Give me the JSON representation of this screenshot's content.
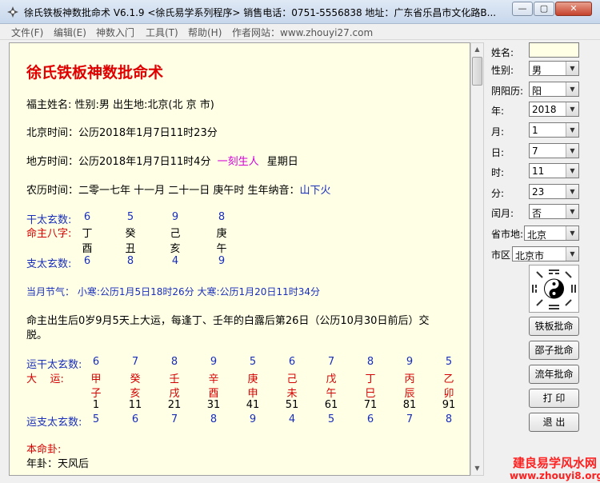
{
  "window": {
    "title": "徐氏铁板神数批命术 V6.1.9 <徐氏易学系列程序>   销售电话：0751-5556838   地址：广东省乐昌市文化路B...",
    "min_btn": "—",
    "max_btn": "▢",
    "close_btn": "✕"
  },
  "menu": [
    "文件(F)",
    "编辑(E)",
    "神数入门",
    "工具(T)",
    "帮助(H)",
    "作者网站：www.zhouyi27.com"
  ],
  "content": {
    "title": "徐氏铁板神数批命术",
    "line_person": "福主姓名:   性别:男   出生地:北京(北 京 市)",
    "line_beijing_time": "北京时间：公历2018年1月7日11时23分",
    "line_local_time_prefix": "地方时间：公历2018年1月7日11时4分",
    "line_local_time_ke": "一刻生人",
    "line_local_time_suffix": "星期日",
    "line_lunar_prefix": "农历时间：二零一七年 十一月 二十一日 庚午时    生年纳音：",
    "line_lunar_nayin": "山下火",
    "bazi": {
      "gan_label": "干太玄数:",
      "gan_nums": [
        "6",
        "5",
        "9",
        "8"
      ],
      "bazi_label": "命主八字:",
      "tiangan": [
        "丁",
        "癸",
        "己",
        "庚"
      ],
      "dizhi": [
        "酉",
        "丑",
        "亥",
        "午"
      ],
      "zhi_label": "支太玄数:",
      "zhi_nums": [
        "6",
        "8",
        "4",
        "9"
      ]
    },
    "jieqi": "当月节气： 小寒:公历1月5日18时26分 大寒:公历1月20日11时34分",
    "dayun_line1": "命主出生后0岁9月5天上大运，每逢丁、壬年的白露后第26日（公历10月30日前后）交",
    "dayun_line2": "脱。",
    "yun": {
      "gan_label": "运干太玄数:",
      "gan_nums": [
        "6",
        "7",
        "8",
        "9",
        "5",
        "6",
        "7",
        "8",
        "9",
        "5"
      ],
      "dayun_label": "大    运:",
      "gan_chars": [
        "甲",
        "癸",
        "壬",
        "辛",
        "庚",
        "己",
        "戊",
        "丁",
        "丙",
        "乙"
      ],
      "zhi_chars": [
        "子",
        "亥",
        "戌",
        "酉",
        "申",
        "未",
        "午",
        "巳",
        "辰",
        "卯"
      ],
      "ages": [
        "1",
        "11",
        "21",
        "31",
        "41",
        "51",
        "61",
        "71",
        "81",
        "91"
      ],
      "zhi_label": "运支太玄数:",
      "zhi_nums": [
        "5",
        "6",
        "7",
        "8",
        "9",
        "4",
        "5",
        "6",
        "7",
        "8"
      ]
    },
    "bengua_label": "本命卦:",
    "bengua_value": "年卦：天风后"
  },
  "panel": {
    "name_label": "姓名:",
    "name_value": "",
    "gender_label": "性别:",
    "gender_value": "男",
    "calendar_label": "阴阳历:",
    "calendar_value": "阳",
    "year_label": "年:",
    "year_value": "2018",
    "month_label": "月:",
    "month_value": "1",
    "day_label": "日:",
    "day_value": "7",
    "hour_label": "时:",
    "hour_value": "11",
    "minute_label": "分:",
    "minute_value": "23",
    "leap_label": "闰月:",
    "leap_value": "否",
    "province_label": "省市地:",
    "province_value": "北京",
    "district_label": "市区",
    "district_value": "北京市",
    "buttons": [
      "铁板批命",
      "邵子批命",
      "流年批命",
      "打 印",
      "退 出"
    ]
  },
  "watermark": {
    "line1": "建良易学风水网",
    "line2": "www.zhouyi8.org"
  },
  "colors": {
    "title_red": "#e00000",
    "accent_blue": "#1a2fb8",
    "accent_magenta": "#d400d4",
    "content_bg": "#ffffe6"
  }
}
